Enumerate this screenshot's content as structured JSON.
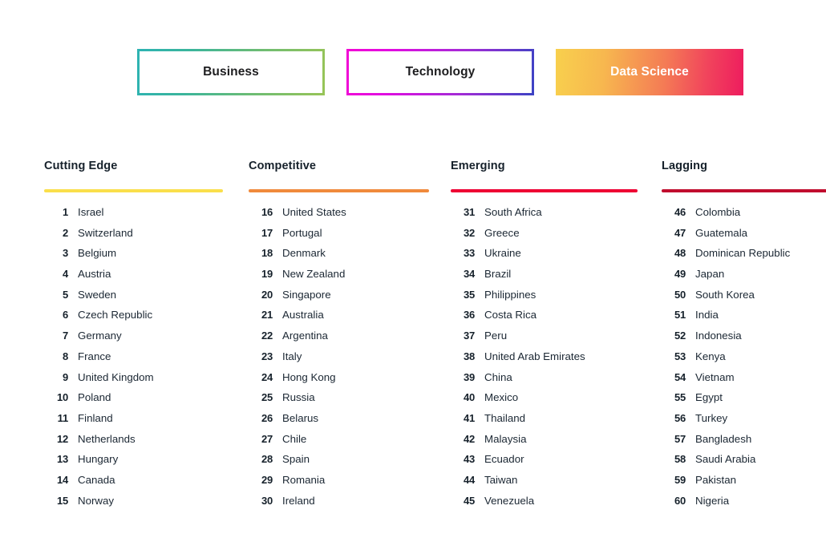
{
  "tabs": [
    {
      "label": "Business",
      "state": "inactive",
      "border_gradient": [
        "#2DB3B3",
        "#98C457"
      ]
    },
    {
      "label": "Technology",
      "state": "inactive",
      "border_gradient": [
        "#F207D4",
        "#3B43C4"
      ]
    },
    {
      "label": "Data Science",
      "state": "active",
      "fill_gradient": [
        "#F8D04D",
        "#F47B55",
        "#EE1C5E"
      ]
    }
  ],
  "columns": [
    {
      "title": "Cutting Edge",
      "rule_color": "#FADF4B",
      "entries": [
        {
          "rank": "1",
          "country": "Israel"
        },
        {
          "rank": "2",
          "country": "Switzerland"
        },
        {
          "rank": "3",
          "country": "Belgium"
        },
        {
          "rank": "4",
          "country": "Austria"
        },
        {
          "rank": "5",
          "country": "Sweden"
        },
        {
          "rank": "6",
          "country": "Czech Republic"
        },
        {
          "rank": "7",
          "country": "Germany"
        },
        {
          "rank": "8",
          "country": "France"
        },
        {
          "rank": "9",
          "country": "United Kingdom"
        },
        {
          "rank": "10",
          "country": "Poland"
        },
        {
          "rank": "11",
          "country": "Finland"
        },
        {
          "rank": "12",
          "country": "Netherlands"
        },
        {
          "rank": "13",
          "country": "Hungary"
        },
        {
          "rank": "14",
          "country": "Canada"
        },
        {
          "rank": "15",
          "country": "Norway"
        }
      ]
    },
    {
      "title": "Competitive",
      "rule_color": "#F08A3C",
      "entries": [
        {
          "rank": "16",
          "country": "United States"
        },
        {
          "rank": "17",
          "country": "Portugal"
        },
        {
          "rank": "18",
          "country": "Denmark"
        },
        {
          "rank": "19",
          "country": "New Zealand"
        },
        {
          "rank": "20",
          "country": "Singapore"
        },
        {
          "rank": "21",
          "country": "Australia"
        },
        {
          "rank": "22",
          "country": "Argentina"
        },
        {
          "rank": "23",
          "country": "Italy"
        },
        {
          "rank": "24",
          "country": "Hong Kong"
        },
        {
          "rank": "25",
          "country": "Russia"
        },
        {
          "rank": "26",
          "country": "Belarus"
        },
        {
          "rank": "27",
          "country": "Chile"
        },
        {
          "rank": "28",
          "country": "Spain"
        },
        {
          "rank": "29",
          "country": "Romania"
        },
        {
          "rank": "30",
          "country": "Ireland"
        }
      ]
    },
    {
      "title": "Emerging",
      "rule_color": "#EE0033",
      "entries": [
        {
          "rank": "31",
          "country": "South Africa"
        },
        {
          "rank": "32",
          "country": "Greece"
        },
        {
          "rank": "33",
          "country": "Ukraine"
        },
        {
          "rank": "34",
          "country": "Brazil"
        },
        {
          "rank": "35",
          "country": "Philippines"
        },
        {
          "rank": "36",
          "country": "Costa Rica"
        },
        {
          "rank": "37",
          "country": "Peru"
        },
        {
          "rank": "38",
          "country": "United Arab Emirates"
        },
        {
          "rank": "39",
          "country": "China"
        },
        {
          "rank": "40",
          "country": "Mexico"
        },
        {
          "rank": "41",
          "country": "Thailand"
        },
        {
          "rank": "42",
          "country": "Malaysia"
        },
        {
          "rank": "43",
          "country": "Ecuador"
        },
        {
          "rank": "44",
          "country": "Taiwan"
        },
        {
          "rank": "45",
          "country": "Venezuela"
        }
      ]
    },
    {
      "title": "Lagging",
      "rule_color": "#C10D2E",
      "entries": [
        {
          "rank": "46",
          "country": "Colombia"
        },
        {
          "rank": "47",
          "country": "Guatemala"
        },
        {
          "rank": "48",
          "country": "Dominican Republic"
        },
        {
          "rank": "49",
          "country": "Japan"
        },
        {
          "rank": "50",
          "country": "South Korea"
        },
        {
          "rank": "51",
          "country": "India"
        },
        {
          "rank": "52",
          "country": "Indonesia"
        },
        {
          "rank": "53",
          "country": "Kenya"
        },
        {
          "rank": "54",
          "country": "Vietnam"
        },
        {
          "rank": "55",
          "country": "Egypt"
        },
        {
          "rank": "56",
          "country": "Turkey"
        },
        {
          "rank": "57",
          "country": "Bangladesh"
        },
        {
          "rank": "58",
          "country": "Saudi Arabia"
        },
        {
          "rank": "59",
          "country": "Pakistan"
        },
        {
          "rank": "60",
          "country": "Nigeria"
        }
      ]
    }
  ]
}
